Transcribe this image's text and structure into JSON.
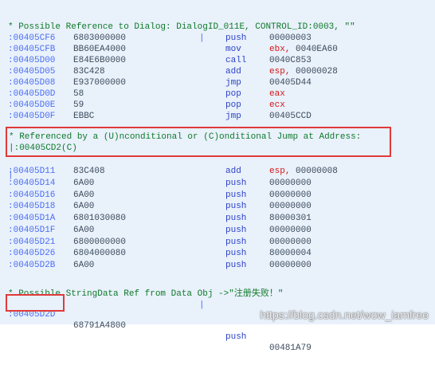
{
  "colors": {
    "background": "#e9f1fb",
    "address": "#4b6ef5",
    "mnemonic": "#2d42c7",
    "register": "#d01818",
    "comment": "#0f7a2a",
    "highlight_border": "#e03a3a"
  },
  "pipe_char": "|",
  "comment_dialog_ref": "* Possible Reference to Dialog: DialogID_011E, CONTROL_ID:0003, \"\"",
  "block1": [
    {
      "addr": ":00405CF6",
      "hex": "6803000000",
      "mnem": "push",
      "ops": "00000003"
    },
    {
      "addr": ":00405CFB",
      "hex": "BB60EA4000",
      "mnem": "mov",
      "reg": "ebx",
      "sep": ",",
      "ops": "0040EA60"
    },
    {
      "addr": ":00405D00",
      "hex": "E84E6B0000",
      "mnem": "call",
      "ops": "0040C853"
    },
    {
      "addr": ":00405D05",
      "hex": "83C428",
      "mnem": "add",
      "reg": "esp",
      "sep": ",",
      "ops": "00000028"
    },
    {
      "addr": ":00405D08",
      "hex": "E937000000",
      "mnem": "jmp",
      "ops": "00405D44"
    },
    {
      "addr": ":00405D0D",
      "hex": "58",
      "mnem": "pop",
      "reg": "eax",
      "ops": ""
    },
    {
      "addr": ":00405D0E",
      "hex": "59",
      "mnem": "pop",
      "reg": "ecx",
      "ops": ""
    },
    {
      "addr": ":00405D0F",
      "hex": "EBBC",
      "mnem": "jmp",
      "ops": "00405CCD"
    }
  ],
  "ref_comment_line1": "* Referenced by a (U)nconditional or (C)onditional Jump at Address:",
  "ref_comment_line2": "|:00405CD2(C)",
  "block2": [
    {
      "addr": ":00405D11",
      "hex": "83C408",
      "mnem": "add",
      "reg": "esp",
      "sep": ",",
      "ops": "00000008"
    },
    {
      "addr": ":00405D14",
      "hex": "6A00",
      "mnem": "push",
      "ops": "00000000"
    },
    {
      "addr": ":00405D16",
      "hex": "6A00",
      "mnem": "push",
      "ops": "00000000"
    },
    {
      "addr": ":00405D18",
      "hex": "6A00",
      "mnem": "push",
      "ops": "00000000"
    },
    {
      "addr": ":00405D1A",
      "hex": "6801030080",
      "mnem": "push",
      "ops": "80000301"
    },
    {
      "addr": ":00405D1F",
      "hex": "6A00",
      "mnem": "push",
      "ops": "00000000"
    },
    {
      "addr": ":00405D21",
      "hex": "6800000000",
      "mnem": "push",
      "ops": "00000000"
    },
    {
      "addr": ":00405D26",
      "hex": "6804000080",
      "mnem": "push",
      "ops": "80000004"
    },
    {
      "addr": ":00405D2B",
      "hex": "6A00",
      "mnem": "push",
      "ops": "00000000"
    }
  ],
  "comment_string_ref": "* Possible StringData Ref from Data Obj ->\"注册失败！\"",
  "last_row": {
    "addr": ":00405D2D",
    "hex": "68791A4800",
    "mnem": "push",
    "ops": "00481A79"
  },
  "watermark": "https://blog.csdn.net/wow_iamfree"
}
